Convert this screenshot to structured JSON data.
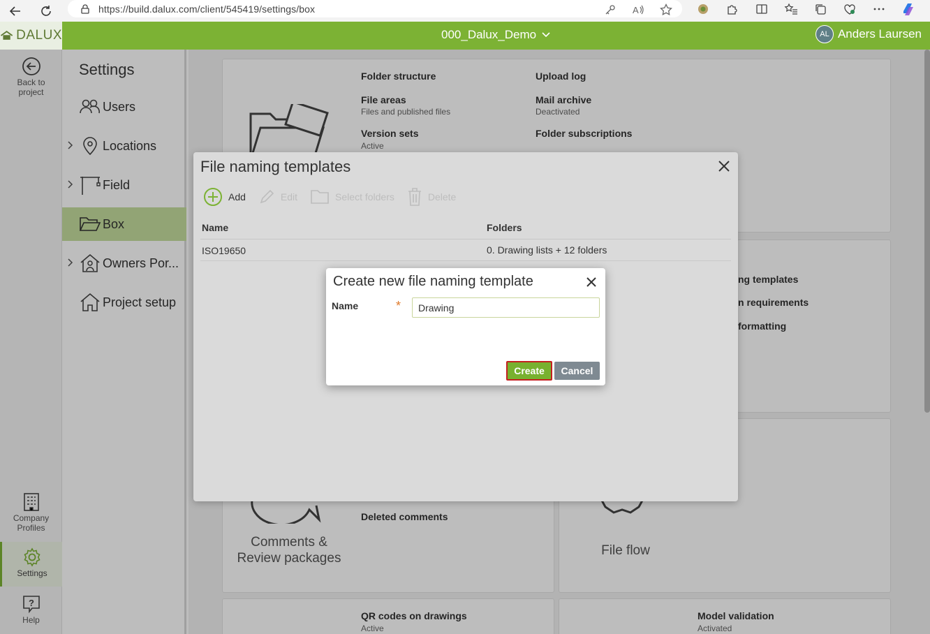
{
  "browser": {
    "url": "https://build.dalux.com/client/545419/settings/box"
  },
  "header": {
    "logo_text": "DALUX",
    "project_name": "000_Dalux_Demo",
    "user_initials": "AL",
    "user_name": "Anders Laursen",
    "brand_color": "#7cb234"
  },
  "rail": {
    "back_label_1": "Back to",
    "back_label_2": "project",
    "company_label_1": "Company",
    "company_label_2": "Profiles",
    "settings_label": "Settings",
    "help_label": "Help"
  },
  "settings_menu": {
    "title": "Settings",
    "items": [
      {
        "label": "Users",
        "expandable": false
      },
      {
        "label": "Locations",
        "expandable": true
      },
      {
        "label": "Field",
        "expandable": true
      },
      {
        "label": "Box",
        "expandable": false,
        "active": true
      },
      {
        "label": "Owners Por...",
        "expandable": true
      },
      {
        "label": "Project setup",
        "expandable": false
      }
    ]
  },
  "cards": {
    "files": {
      "folder_structure": "Folder structure",
      "file_areas": "File areas",
      "file_areas_sub": "Files and published files",
      "version_sets": "Version sets",
      "version_sets_sub": "Active",
      "upload_log": "Upload log",
      "mail_archive": "Mail archive",
      "mail_archive_sub": "Deactivated",
      "folder_subscriptions": "Folder subscriptions"
    },
    "naming": {
      "partial_1": "ng templates",
      "partial_2": "n requirements",
      "partial_3": "formatting"
    },
    "comments": {
      "deleted_comments": "Deleted comments",
      "title_1": "Comments &",
      "title_2": "Review packages"
    },
    "file_flow": {
      "title": "File flow"
    },
    "qr": {
      "label": "QR codes on drawings",
      "sub": "Active"
    },
    "model": {
      "label": "Model validation",
      "sub": "Activated"
    }
  },
  "file_naming_dialog": {
    "title": "File naming templates",
    "toolbar": {
      "add": "Add",
      "edit": "Edit",
      "select_folders": "Select folders",
      "delete": "Delete"
    },
    "columns": [
      "Name",
      "Folders"
    ],
    "rows": [
      {
        "name": "ISO19650",
        "folders": "0. Drawing lists + 12 folders"
      }
    ]
  },
  "create_dialog": {
    "title": "Create new file naming template",
    "name_label": "Name",
    "required_mark": "*",
    "name_value": "Drawing",
    "create_label": "Create",
    "cancel_label": "Cancel"
  }
}
